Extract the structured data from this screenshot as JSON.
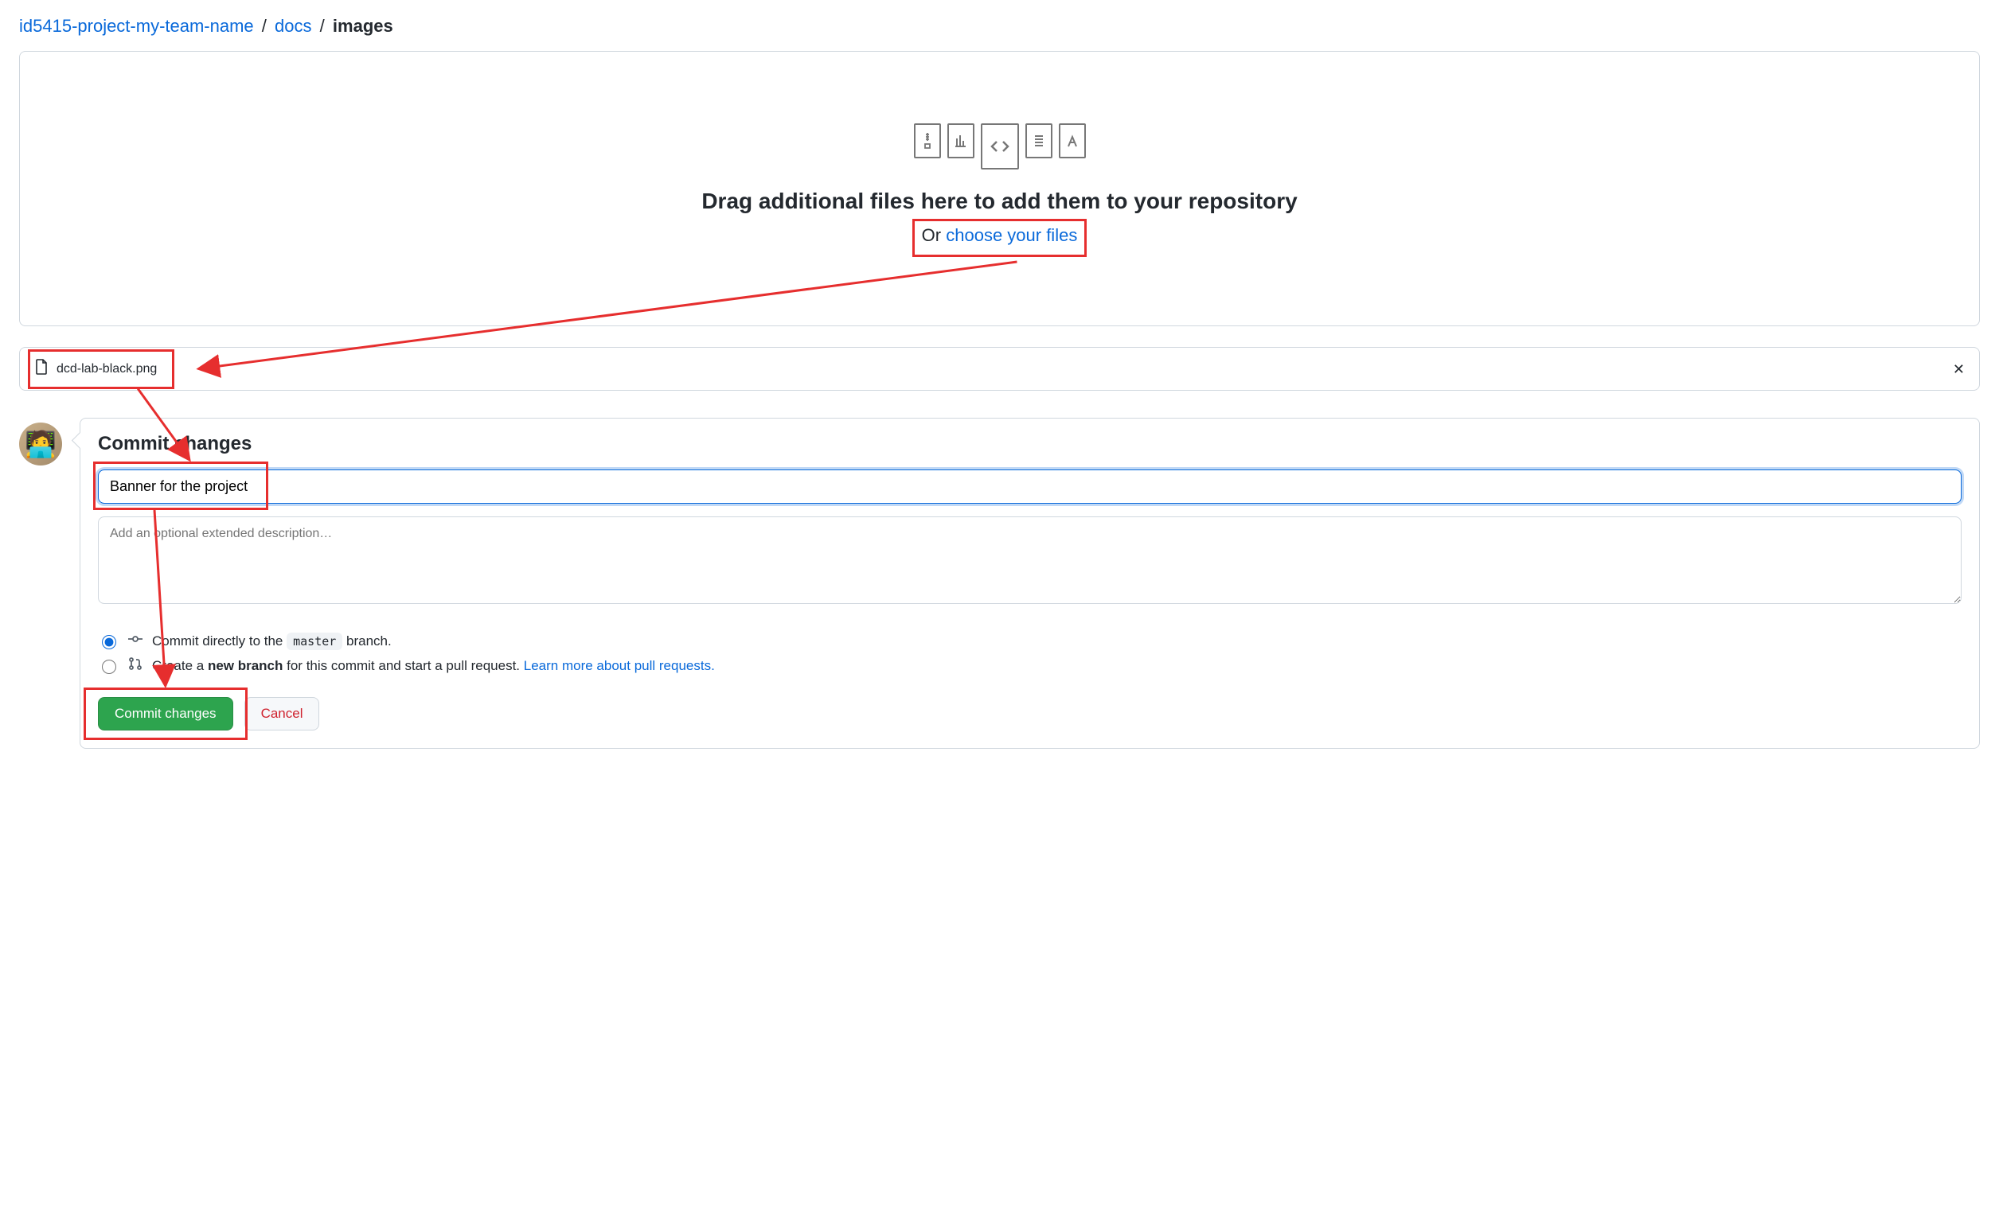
{
  "breadcrumb": {
    "repo": "id5415-project-my-team-name",
    "path1": "docs",
    "path2": "images"
  },
  "drop": {
    "heading": "Drag additional files here to add them to your repository",
    "or": "Or ",
    "choose": "choose your files"
  },
  "file": {
    "name": "dcd-lab-black.png"
  },
  "commit": {
    "title": "Commit changes",
    "summary_value": "Banner for the project",
    "desc_placeholder": "Add an optional extended description…",
    "radio_direct_prefix": "Commit directly to the ",
    "branch_name": "master",
    "radio_direct_suffix": " branch.",
    "radio_new_prefix": "Create a ",
    "radio_new_strong": "new branch",
    "radio_new_suffix": " for this commit and start a pull request. ",
    "learn_more": "Learn more about pull requests.",
    "submit": "Commit changes",
    "cancel": "Cancel"
  }
}
